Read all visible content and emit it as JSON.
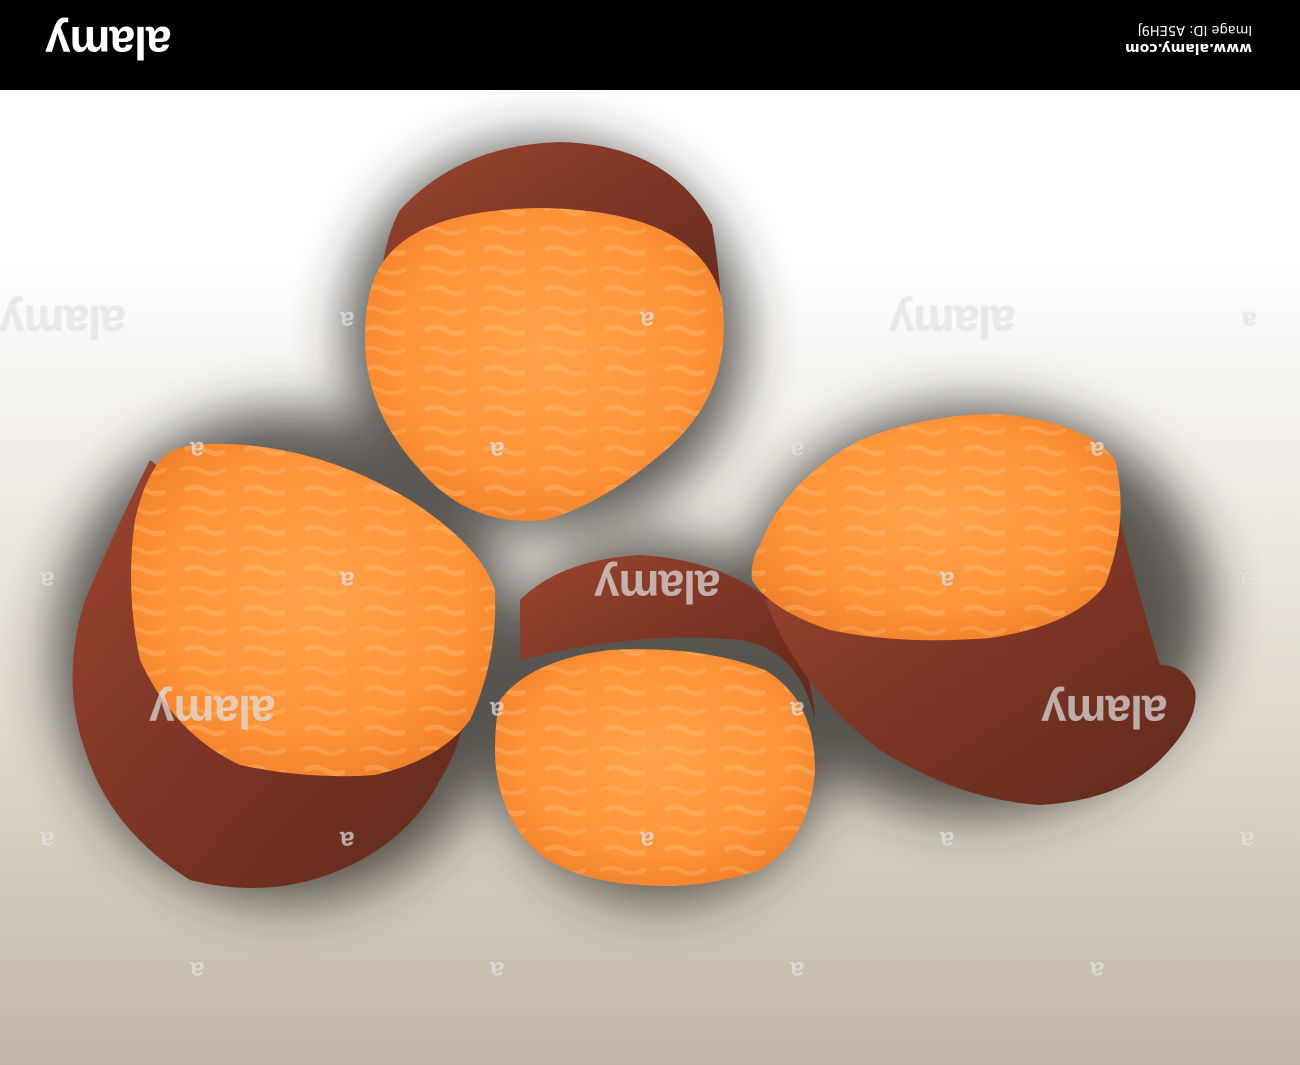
{
  "banner": {
    "brand": "alamy",
    "url": "www.alamy.com",
    "image_id": "Image ID: A5EH9J"
  },
  "photo": {
    "subject_icon": "sweet-potato-halves-photo",
    "colors": {
      "flesh": "#ff9a3a",
      "skin": "#8a3a2a",
      "banner": "#000000"
    }
  },
  "watermark": {
    "logo": "alamy",
    "mark": "a"
  }
}
